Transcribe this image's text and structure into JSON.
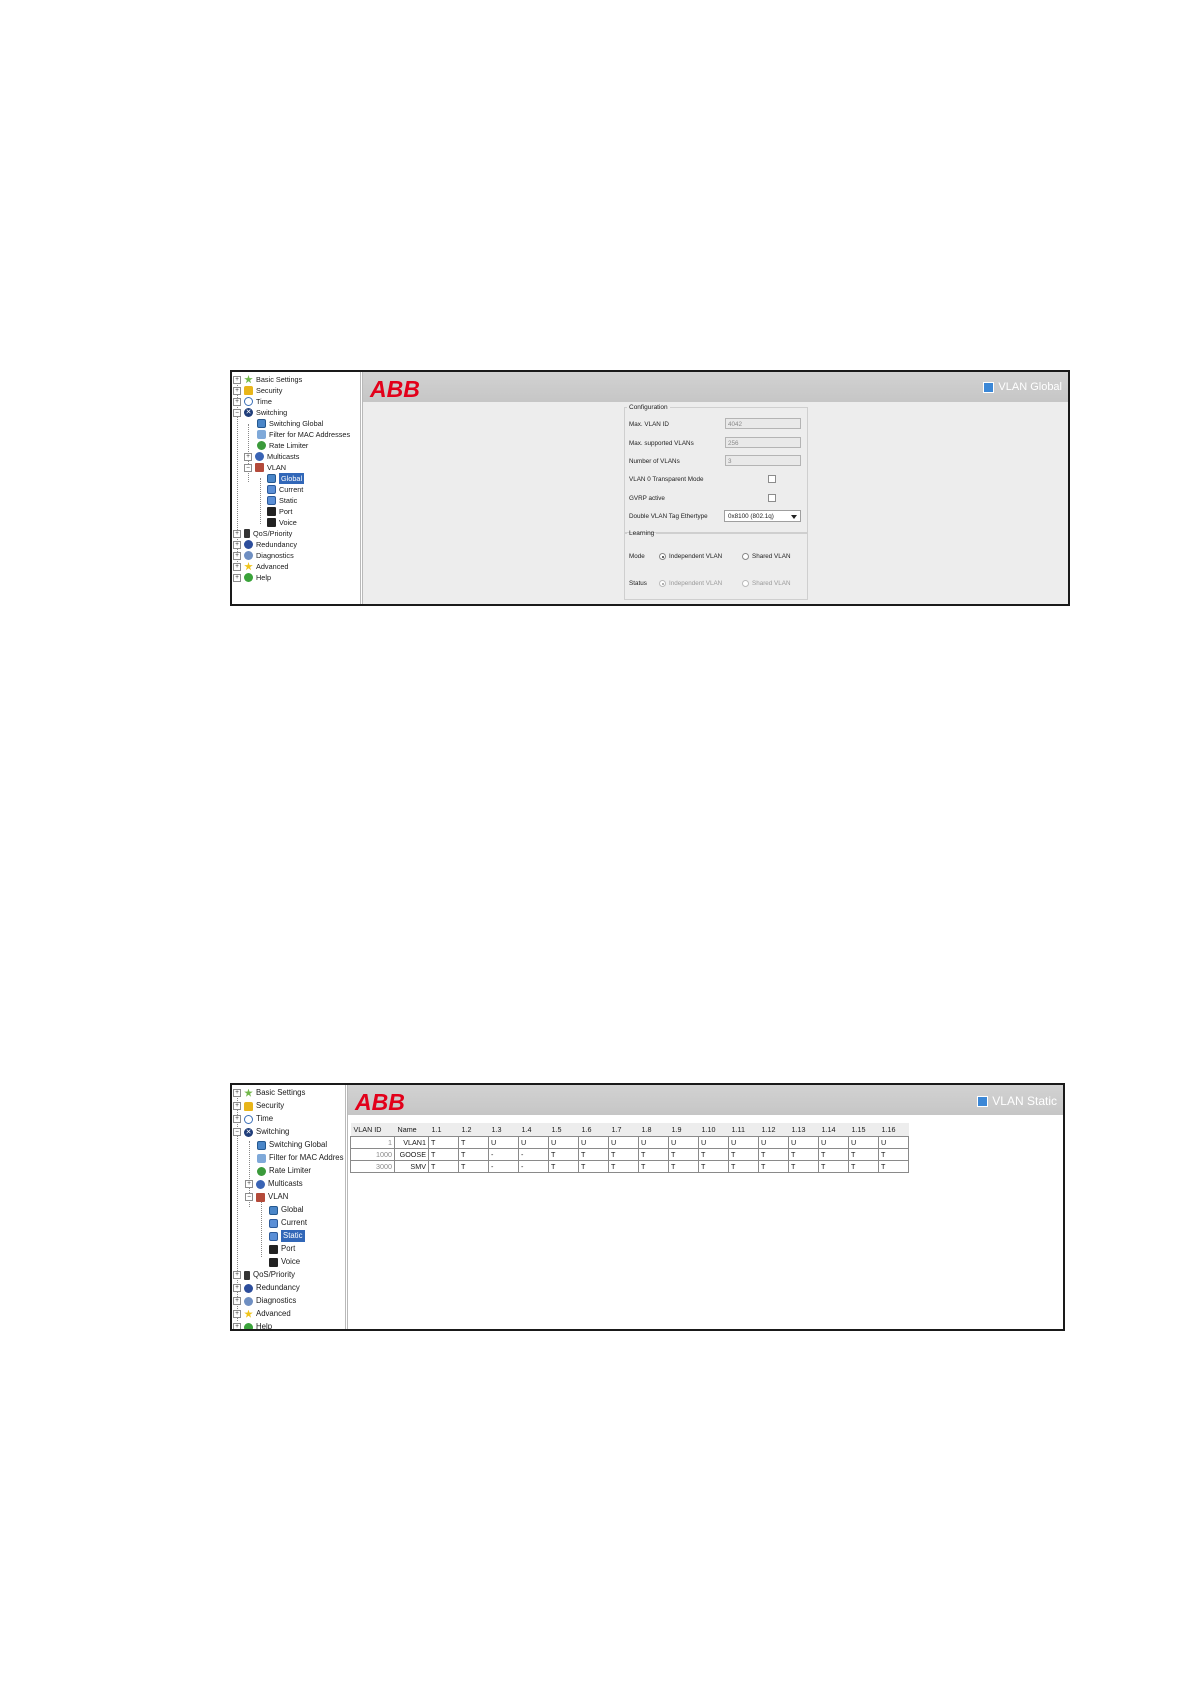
{
  "screen1": {
    "logo": "ABB",
    "page_title": "VLAN Global",
    "tree": {
      "basic_settings": "Basic Settings",
      "security": "Security",
      "time": "Time",
      "switching": "Switching",
      "switching_global": "Switching Global",
      "filter_mac": "Filter for MAC Addresses",
      "rate_limiter": "Rate Limiter",
      "multicasts": "Multicasts",
      "vlan": "VLAN",
      "global": "Global",
      "current": "Current",
      "static": "Static",
      "port": "Port",
      "voice": "Voice",
      "qos": "QoS/Priority",
      "redundancy": "Redundancy",
      "diagnostics": "Diagnostics",
      "advanced": "Advanced",
      "help": "Help"
    },
    "configuration": {
      "legend": "Configuration",
      "max_vlan_id_label": "Max. VLAN ID",
      "max_vlan_id_value": "4042",
      "max_supported_label": "Max. supported VLANs",
      "max_supported_value": "256",
      "num_vlans_label": "Number of VLANs",
      "num_vlans_value": "3",
      "vlan0_label": "VLAN 0 Transparent Mode",
      "gvrp_label": "GVRP active",
      "ethertype_label": "Double VLAN Tag Ethertype",
      "ethertype_value": "0x8100 (802.1q)"
    },
    "learning": {
      "legend": "Learning",
      "mode_label": "Mode",
      "status_label": "Status",
      "independent": "Independent VLAN",
      "shared": "Shared VLAN"
    }
  },
  "screen2": {
    "logo": "ABB",
    "page_title": "VLAN Static",
    "tree": {
      "basic_settings": "Basic Settings",
      "security": "Security",
      "time": "Time",
      "switching": "Switching",
      "switching_global": "Switching Global",
      "filter_mac": "Filter for MAC Addres",
      "rate_limiter": "Rate Limiter",
      "multicasts": "Multicasts",
      "vlan": "VLAN",
      "global": "Global",
      "current": "Current",
      "static": "Static",
      "port": "Port",
      "voice": "Voice",
      "qos": "QoS/Priority",
      "redundancy": "Redundancy",
      "diagnostics": "Diagnostics",
      "advanced": "Advanced",
      "help": "Help"
    },
    "table": {
      "headers": [
        "VLAN ID",
        "Name",
        "1.1",
        "1.2",
        "1.3",
        "1.4",
        "1.5",
        "1.6",
        "1.7",
        "1.8",
        "1.9",
        "1.10",
        "1.11",
        "1.12",
        "1.13",
        "1.14",
        "1.15",
        "1.16"
      ],
      "rows": [
        {
          "id": "1",
          "name": "VLAN1",
          "ports": [
            "T",
            "T",
            "U",
            "U",
            "U",
            "U",
            "U",
            "U",
            "U",
            "U",
            "U",
            "U",
            "U",
            "U",
            "U",
            "U"
          ]
        },
        {
          "id": "1000",
          "name": "GOOSE",
          "ports": [
            "T",
            "T",
            "-",
            "-",
            "T",
            "T",
            "T",
            "T",
            "T",
            "T",
            "T",
            "T",
            "T",
            "T",
            "T",
            "T"
          ]
        },
        {
          "id": "3000",
          "name": "SMV",
          "ports": [
            "T",
            "T",
            "-",
            "-",
            "T",
            "T",
            "T",
            "T",
            "T",
            "T",
            "T",
            "T",
            "T",
            "T",
            "T",
            "T"
          ]
        }
      ]
    }
  }
}
